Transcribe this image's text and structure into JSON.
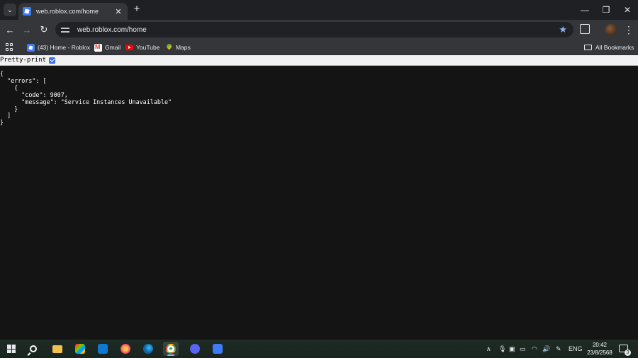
{
  "browser": {
    "tab": {
      "title": "web.roblox.com/home"
    },
    "address_bar": {
      "url": "web.roblox.com/home"
    },
    "bookmarks": [
      {
        "label": "(43) Home - Roblox",
        "icon": "roblox-icon"
      },
      {
        "label": "Gmail",
        "icon": "gmail-icon"
      },
      {
        "label": "YouTube",
        "icon": "youtube-icon"
      },
      {
        "label": "Maps",
        "icon": "maps-icon"
      }
    ],
    "all_bookmarks_label": "All Bookmarks"
  },
  "content": {
    "pretty_print_label": "Pretty-print",
    "pretty_print_checked": true,
    "json_lines": [
      "{",
      "  \"errors\": [",
      "    {",
      "      \"code\": 9007,",
      "      \"message\": \"Service Instances Unavailable\"",
      "    }",
      "  ]",
      "}"
    ]
  },
  "taskbar": {
    "language": "ENG",
    "time": "20:42",
    "date": "23/8/2568",
    "notification_count": "3",
    "colors": {
      "accent": "#8ab4f8",
      "taskbar_bg": "#1c2a22"
    }
  }
}
